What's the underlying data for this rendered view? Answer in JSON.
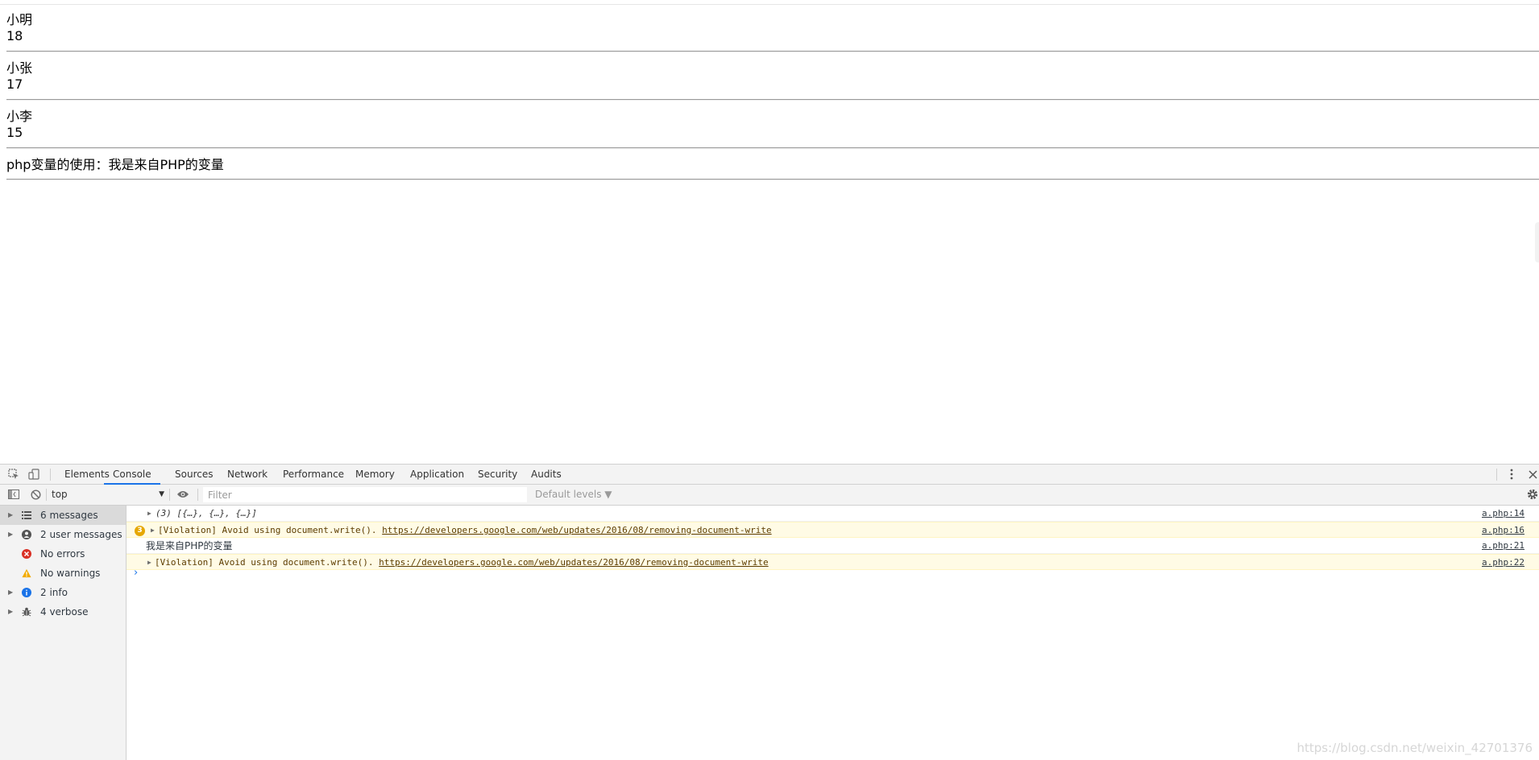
{
  "page": {
    "entries": [
      {
        "name": "小明",
        "age": "18"
      },
      {
        "name": "小张",
        "age": "17"
      },
      {
        "name": "小李",
        "age": "15"
      }
    ],
    "php_line": "php变量的使用：我是来自PHP的变量"
  },
  "devtools": {
    "tabs": [
      {
        "label": "Elements"
      },
      {
        "label": "Console",
        "active": true
      },
      {
        "label": "Sources"
      },
      {
        "label": "Network"
      },
      {
        "label": "Performance"
      },
      {
        "label": "Memory"
      },
      {
        "label": "Application"
      },
      {
        "label": "Security"
      },
      {
        "label": "Audits"
      }
    ],
    "toolbar": {
      "context": "top",
      "filter_placeholder": "Filter",
      "levels": "Default levels ▼"
    },
    "sidebar": {
      "items": [
        {
          "icon": "list-icon",
          "label": "6 messages",
          "selected": true
        },
        {
          "icon": "user-icon",
          "label": "2 user messages"
        },
        {
          "icon": "error-icon",
          "label": "No errors"
        },
        {
          "icon": "warning-icon",
          "label": "No warnings"
        },
        {
          "icon": "info-icon",
          "label": "2 info"
        },
        {
          "icon": "bug-icon",
          "label": "4 verbose"
        }
      ]
    },
    "messages": [
      {
        "type": "log",
        "text": "(3) [{…}, {…}, {…}]",
        "source": "a.php:14"
      },
      {
        "type": "violation",
        "count": "3",
        "prefix": "[Violation] Avoid using document.write(). ",
        "link": "https://developers.google.com/web/updates/2016/08/removing-document-write",
        "source": "a.php:16"
      },
      {
        "type": "log",
        "text": "我是来自PHP的变量",
        "source": "a.php:21"
      },
      {
        "type": "violation",
        "prefix": "[Violation] Avoid using document.write(). ",
        "link": "https://developers.google.com/web/updates/2016/08/removing-document-write",
        "source": "a.php:22"
      }
    ],
    "prompt": "›",
    "watermark": "https://blog.csdn.net/weixin_42701376"
  },
  "colors": {
    "accent": "#1a73e8",
    "warning_bg": "#fffbe5",
    "warning_badge": "#e6a700",
    "error": "#d93025",
    "info": "#1a73e8"
  }
}
